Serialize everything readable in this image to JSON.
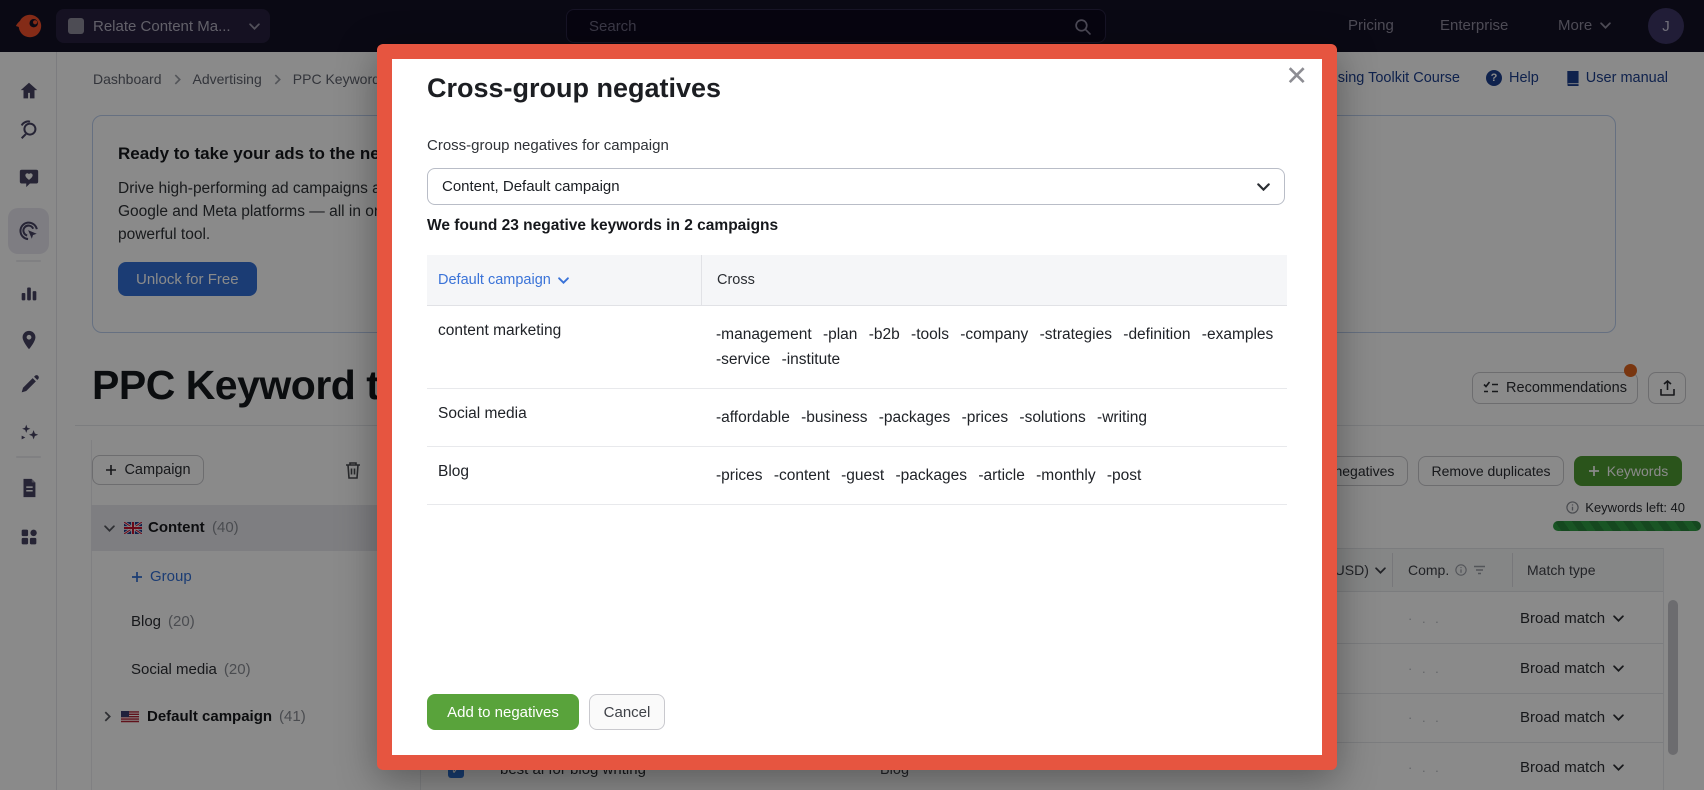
{
  "topbar": {
    "project_name": "Relate Content Ma...",
    "search_placeholder": "Search",
    "pricing": "Pricing",
    "enterprise": "Enterprise",
    "more": "More",
    "avatar_initial": "J"
  },
  "breadcrumb": {
    "level1": "Dashboard",
    "level2": "Advertising",
    "level3": "PPC Keyword tool"
  },
  "header_links": {
    "course": "Advertising Toolkit Course",
    "help": "Help",
    "user_manual": "User manual"
  },
  "promo": {
    "title": "Ready to take your ads to the next level?",
    "body_line1": "Drive high-performing ad campaigns across",
    "body_line2": "Google and Meta platforms — all in one",
    "body_line3": "powerful tool.",
    "cta": "Unlock for Free"
  },
  "page": {
    "title": "PPC Keyword tool"
  },
  "campaigns_panel": {
    "campaign_button": "Campaign",
    "content_group": {
      "name": "Content",
      "count": "(40)"
    },
    "add_group": "Group",
    "blog": {
      "name": "Blog",
      "count": "(20)"
    },
    "social": {
      "name": "Social media",
      "count": "(20)"
    },
    "default_campaign": {
      "name": "Default campaign",
      "count": "(41)"
    }
  },
  "toolbar": {
    "recommendations": "Recommendations",
    "negatives_button": "Cross-group negatives",
    "remove_duplicates": "Remove duplicates",
    "add_keywords": "Keywords",
    "keywords_left": "Keywords left: 40"
  },
  "keyword_table": {
    "usd_header": "(USD)",
    "comp_header": "Comp.",
    "match_type_header": "Match type",
    "empty_cell": "· . .",
    "rows": [
      {
        "match": "Broad match"
      },
      {
        "match": "Broad match"
      },
      {
        "match": "Broad match"
      },
      {
        "match": "Broad match"
      }
    ],
    "visible_row": {
      "keyword": "best ai for blog writing",
      "group": "Blog"
    }
  },
  "modal": {
    "title": "Cross-group negatives",
    "close_label": "✕",
    "campaign_select_label": "Cross-group negatives for campaign",
    "campaign_select_value": "Content, Default campaign",
    "summary": "We found 23 negative keywords in 2 campaigns",
    "table": {
      "group_column_header": "Default campaign",
      "cross_column_header": "Cross",
      "rows": [
        {
          "group": "content marketing",
          "negatives": "-management -plan -b2b -tools -company -strategies -definition -examples -service -institute"
        },
        {
          "group": "Social media",
          "negatives": "-affordable -business -packages -prices -solutions -writing"
        },
        {
          "group": "Blog",
          "negatives": "-prices -content -guest -packages -article -monthly -post"
        }
      ]
    },
    "add_button": "Add to negatives",
    "cancel_button": "Cancel"
  },
  "colors": {
    "accent_orange": "#e65540",
    "green": "#59a33b",
    "blue": "#3270d6",
    "topbar_bg": "#141126"
  }
}
